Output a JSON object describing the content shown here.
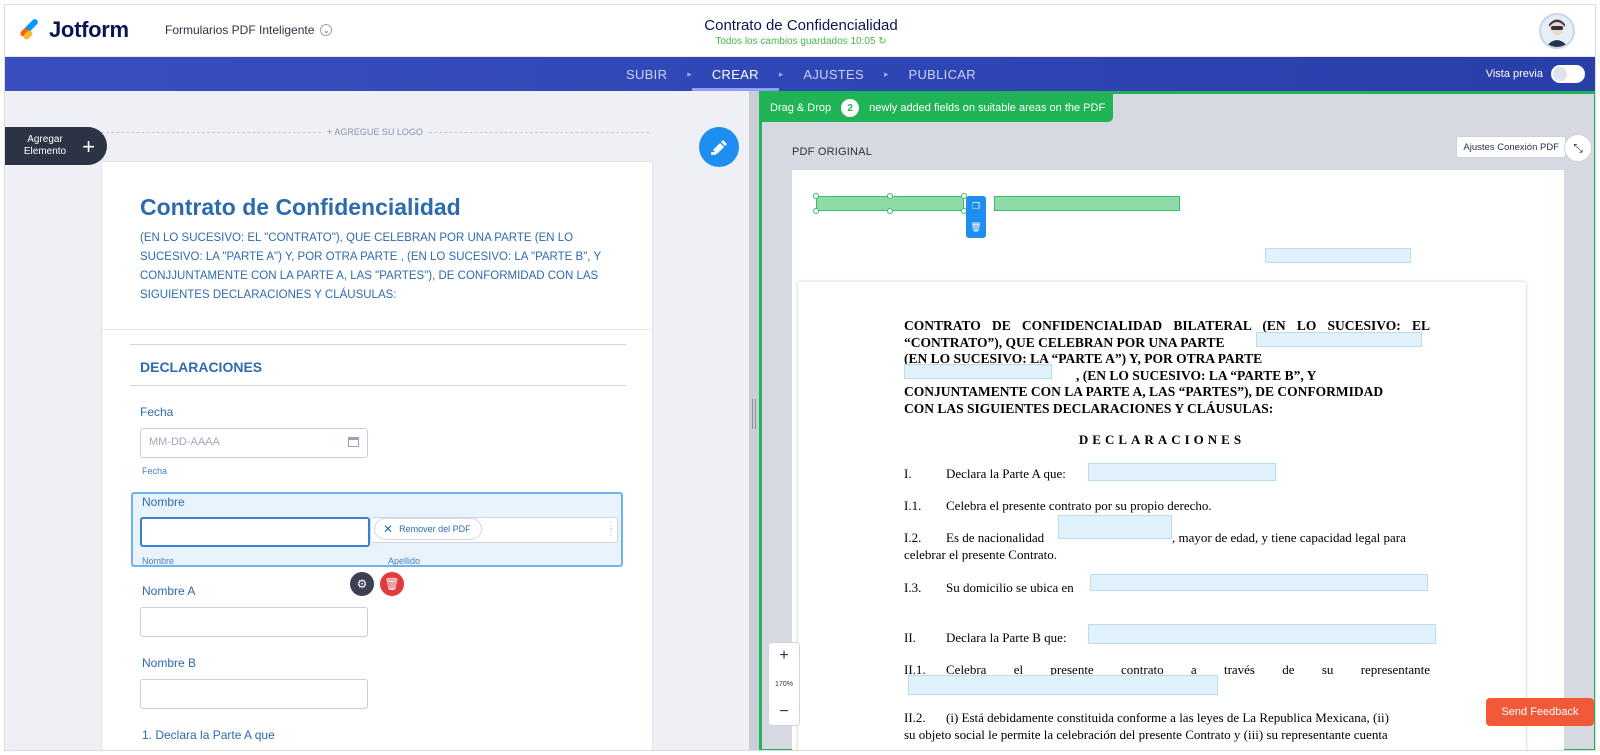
{
  "header": {
    "brand": "Jotform",
    "product": "Formularios PDF Inteligente",
    "doc_title": "Contrato de Confidencialidad",
    "saved_status": "Todos los cambios guardados 10:05 ↻"
  },
  "nav": {
    "steps": [
      "SUBIR",
      "CREAR",
      "AJUSTES",
      "PUBLICAR"
    ],
    "active": "CREAR",
    "preview_label": "Vista previa"
  },
  "left": {
    "add_element": "Agregar Elemento",
    "add_logo": "+ AGREGUE SU LOGO",
    "form_title": "Contrato de Confidencialidad",
    "form_subtitle": "(EN LO SUCESIVO: EL \"CONTRATO\"), QUE CELEBRAN POR UNA PARTE (EN LO SUCESIVO: LA \"PARTE A\") Y, POR OTRA PARTE , (EN LO SUCESIVO: LA \"PARTE B\", Y CONJJUNTAMENTE CON LA PARTE A, LAS \"PARTES\"), DE CONFORMIDAD CON LAS SIGUIENTES DECLARACIONES Y CLÁUSULAS:",
    "section": "DECLARACIONES",
    "fecha_label": "Fecha",
    "fecha_placeholder": "MM-DD-AAAA",
    "fecha_sublabel": "Fecha",
    "nombre_label": "Nombre",
    "nombre_sublabel": "Nombre",
    "apellido_sublabel": "Apellido",
    "remove_pdf": "Remover del PDF",
    "nombre_a_label": "Nombre A",
    "nombre_b_label": "Nombre B",
    "next_label": "1. Declara la Parte A que"
  },
  "right": {
    "banner_prefix": "Drag & Drop",
    "banner_count": "2",
    "banner_suffix": "newly added fields on suitable areas on the PDF",
    "pdf_label": "PDF ORIGINAL",
    "settings_button": "Ajustes Conexión PDF",
    "zoom_level": "170%",
    "feedback": "Send Feedback"
  },
  "document": {
    "para_1": "CONTRATO DE CONFIDENCIALIDAD BILATERAL (EN LO SUCESIVO: EL “CONTRATO”), QUE CELEBRAN POR UNA PARTE",
    "para_2": "(EN LO SUCESIVO: LA “PARTE A”) Y, POR OTRA PARTE",
    "para_3": ", (EN LO SUCESIVO: LA “PARTE B”, Y",
    "para_4": "CONJUNTAMENTE CON LA PARTE A, LAS “PARTES”), DE CONFORMIDAD",
    "para_5": "CON LAS SIGUIENTES DECLARACIONES Y CLÁUSULAS:",
    "heading": "DECLARACIONES",
    "items": [
      {
        "num": "I.",
        "text": "Declara la Parte A que:"
      },
      {
        "num": "I.1.",
        "text": "Celebra el presente contrato por su propio derecho."
      },
      {
        "num": "I.2.",
        "text": "Es de nacionalidad"
      },
      {
        "num": "I.3.",
        "text": "Su domicilio se ubica en"
      },
      {
        "num": "II.",
        "text": "Declara la Parte B que:"
      },
      {
        "num": "II.1.",
        "text": "Celebra el presente contrato a través de su representante"
      },
      {
        "num": "II.2.",
        "text": "(i) Está debidamente constituida conforme a las leyes de La Republica Mexicana, (ii)"
      }
    ],
    "i2_tail": ", mayor de edad, y tiene capacidad legal para",
    "i2_cont": "celebrar el presente Contrato.",
    "ii2_cont": "su objeto social le permite la celebración del presente Contrato y (iii) su representante cuenta"
  },
  "colors": {
    "brand_navy": "#0a1551",
    "nav_blue": "#3a4fbf",
    "form_blue": "#2d6bb0",
    "green": "#21b456",
    "feedback": "#f05a38"
  }
}
